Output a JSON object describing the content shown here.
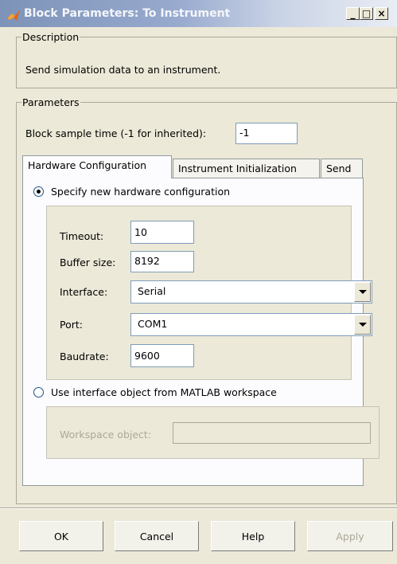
{
  "window": {
    "title": "Block Parameters: To Instrument",
    "minimize_glyph": "_",
    "maximize_glyph": "□",
    "close_glyph": "×"
  },
  "description": {
    "legend": "Description",
    "text": "Send simulation data to an instrument."
  },
  "parameters": {
    "legend": "Parameters",
    "sample_time_label": "Block sample time (-1 for inherited):",
    "sample_time_value": "-1"
  },
  "tabs": [
    {
      "label": "Hardware Configuration",
      "active": true
    },
    {
      "label": "Instrument Initialization",
      "active": false
    },
    {
      "label": "Send",
      "active": false
    }
  ],
  "hardware": {
    "specify_option_label": "Specify new hardware configuration",
    "specify_selected": true,
    "timeout_label": "Timeout:",
    "timeout_value": "10",
    "buffer_label": "Buffer size:",
    "buffer_value": "8192",
    "interface_label": "Interface:",
    "interface_value": "Serial",
    "port_label": "Port:",
    "port_value": "COM1",
    "baudrate_label": "Baudrate:",
    "baudrate_value": "9600",
    "use_object_option_label": "Use interface object from MATLAB workspace",
    "use_object_selected": false,
    "workspace_label": "Workspace object:",
    "workspace_value": ""
  },
  "buttons": {
    "ok": "OK",
    "cancel": "Cancel",
    "help": "Help",
    "apply": "Apply"
  },
  "colors": {
    "title_gradient_start": "#7d93b8",
    "dialog_bg": "#ece9d8",
    "disabled_text": "#aca899"
  },
  "icons": {
    "title": "matlab-logo-icon",
    "dropdown": "chevron-down-icon"
  }
}
